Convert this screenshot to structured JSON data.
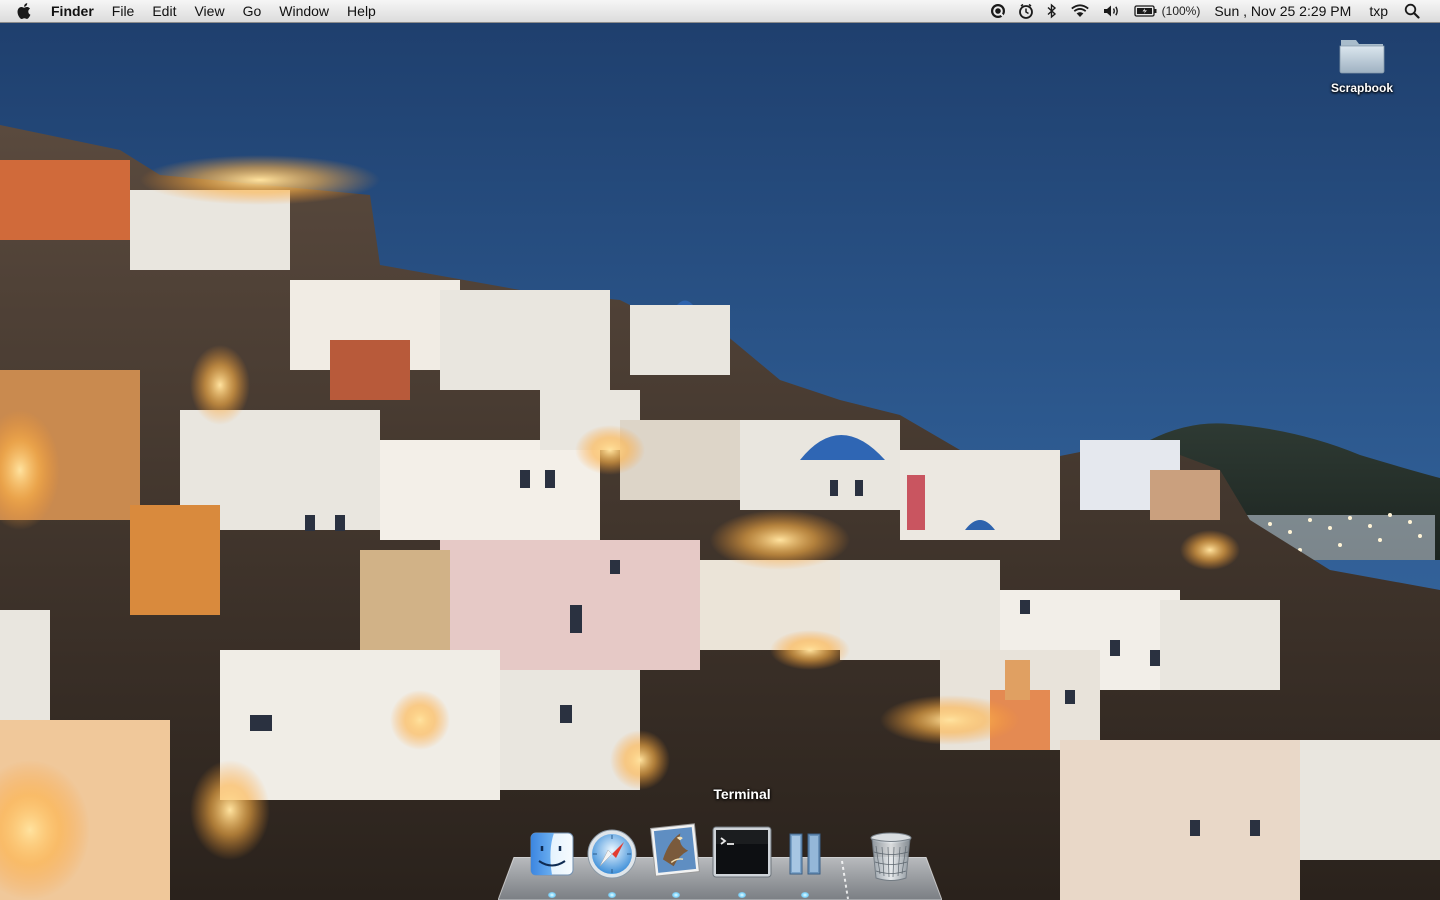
{
  "menubar": {
    "app_name": "Finder",
    "menus": [
      "File",
      "Edit",
      "View",
      "Go",
      "Window",
      "Help"
    ],
    "status_icons": [
      "quicksilver-icon",
      "time-machine-icon",
      "bluetooth-icon",
      "wifi-icon",
      "volume-icon",
      "battery-icon"
    ],
    "battery_percent": "(100%)",
    "clock": "Sun , Nov 25  2:29 PM",
    "username": "txp"
  },
  "desktop": {
    "icons": [
      {
        "label": "Scrapbook",
        "icon": "folder-icon"
      }
    ]
  },
  "dock": {
    "tooltip": "Terminal",
    "apps": [
      {
        "icon": "finder-icon",
        "running": true
      },
      {
        "icon": "safari-icon",
        "running": true
      },
      {
        "icon": "mail-icon",
        "running": true
      },
      {
        "icon": "terminal-icon",
        "running": true
      },
      {
        "icon": "applications-stack-icon",
        "running": true
      },
      {
        "icon": "trash-icon",
        "running": false
      }
    ]
  },
  "colors": {
    "sky_top": "#1e3f6f",
    "sky_bottom": "#3a6aa6",
    "menubar": "#e8e8e8",
    "accent_glow": "#ffb347"
  }
}
